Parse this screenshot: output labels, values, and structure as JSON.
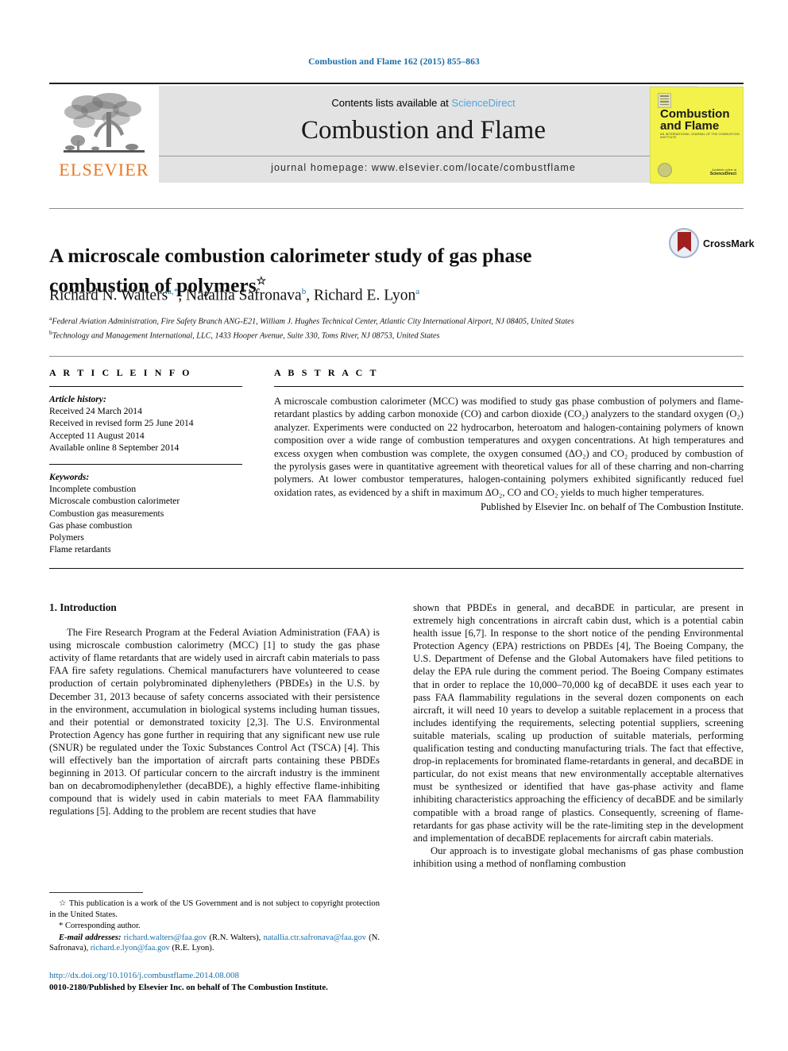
{
  "running_head": "Combustion and Flame 162 (2015) 855–863",
  "masthead": {
    "contents_prefix": "Contents lists available at ",
    "sciencedirect": "ScienceDirect",
    "journal_title": "Combustion and Flame",
    "homepage": "journal homepage: www.elsevier.com/locate/combustflame",
    "publisher_logo_text": "ELSEVIER",
    "cover": {
      "title_line1": "Combustion",
      "title_line2": "and Flame",
      "subtitle": "AN INTERNATIONAL JOURNAL OF THE COMBUSTION INSTITUTE",
      "footer_small": "Available online at",
      "footer_brand": "ScienceDirect"
    }
  },
  "article": {
    "title": "A microscale combustion calorimeter study of gas phase combustion of polymers",
    "title_footnote_marker": "☆",
    "crossmark_label": "CrossMark",
    "authors": [
      {
        "name": "Richard N. Walters",
        "sup": "a,*"
      },
      {
        "name": "Natallia Safronava",
        "sup": "b"
      },
      {
        "name": "Richard E. Lyon",
        "sup": "a"
      }
    ],
    "affiliations": [
      {
        "marker": "a",
        "text": "Federal Aviation Administration, Fire Safety Branch ANG-E21, William J. Hughes Technical Center, Atlantic City International Airport, NJ 08405, United States"
      },
      {
        "marker": "b",
        "text": "Technology and Management International, LLC, 1433 Hooper Avenue, Suite 330, Toms River, NJ 08753, United States"
      }
    ]
  },
  "article_info": {
    "heading": "A R T I C L E   I N F O",
    "history_label": "Article history:",
    "history": [
      "Received 24 March 2014",
      "Received in revised form 25 June 2014",
      "Accepted 11 August 2014",
      "Available online 8 September 2014"
    ],
    "keywords_label": "Keywords:",
    "keywords": [
      "Incomplete combustion",
      "Microscale combustion calorimeter",
      "Combustion gas measurements",
      "Gas phase combustion",
      "Polymers",
      "Flame retardants"
    ]
  },
  "abstract": {
    "heading": "A B S T R A C T",
    "body": "A microscale combustion calorimeter (MCC) was modified to study gas phase combustion of polymers and flame-retardant plastics by adding carbon monoxide (CO) and carbon dioxide (CO₂) analyzers to the standard oxygen (O₂) analyzer. Experiments were conducted on 22 hydrocarbon, heteroatom and halogen-containing polymers of known composition over a wide range of combustion temperatures and oxygen concentrations. At high temperatures and excess oxygen when combustion was complete, the oxygen consumed (ΔO₂) and CO₂ produced by combustion of the pyrolysis gases were in quantitative agreement with theoretical values for all of these charring and non-charring polymers. At lower combustor temperatures, halogen-containing polymers exhibited significantly reduced fuel oxidation rates, as evidenced by a shift in maximum ΔO₂, CO and CO₂ yields to much higher temperatures.",
    "publisher_line": "Published by Elsevier Inc. on behalf of The Combustion Institute."
  },
  "body": {
    "section_heading": "1. Introduction",
    "left_paragraph": "The Fire Research Program at the Federal Aviation Administration (FAA) is using microscale combustion calorimetry (MCC) [1] to study the gas phase activity of flame retardants that are widely used in aircraft cabin materials to pass FAA fire safety regulations. Chemical manufacturers have volunteered to cease production of certain polybrominated diphenylethers (PBDEs) in the U.S. by December 31, 2013 because of safety concerns associated with their persistence in the environment, accumulation in biological systems including human tissues, and their potential or demonstrated toxicity [2,3]. The U.S. Environmental Protection Agency has gone further in requiring that any significant new use rule (SNUR) be regulated under the Toxic Substances Control Act (TSCA) [4]. This will effectively ban the importation of aircraft parts containing these PBDEs beginning in 2013. Of particular concern to the aircraft industry is the imminent ban on decabromodiphenylether (decaBDE), a highly effective flame-inhibiting compound that is widely used in cabin materials to meet FAA flammability regulations [5]. Adding to the problem are recent studies that have",
    "right_paragraph_1": "shown that PBDEs in general, and decaBDE in particular, are present in extremely high concentrations in aircraft cabin dust, which is a potential cabin health issue [6,7]. In response to the short notice of the pending Environmental Protection Agency (EPA) restrictions on PBDEs [4], The Boeing Company, the U.S. Department of Defense and the Global Automakers have filed petitions to delay the EPA rule during the comment period. The Boeing Company estimates that in order to replace the 10,000–70,000 kg of decaBDE it uses each year to pass FAA flammability regulations in the several dozen components on each aircraft, it will need 10 years to develop a suitable replacement in a process that includes identifying the requirements, selecting potential suppliers, screening suitable materials, scaling up production of suitable materials, performing qualification testing and conducting manufacturing trials. The fact that effective, drop-in replacements for brominated flame-retardants in general, and decaBDE in particular, do not exist means that new environmentally acceptable alternatives must be synthesized or identified that have gas-phase activity and flame inhibiting characteristics approaching the efficiency of decaBDE and be similarly compatible with a broad range of plastics. Consequently, screening of flame-retardants for gas phase activity will be the rate-limiting step in the development and implementation of decaBDE replacements for aircraft cabin materials.",
    "right_paragraph_2": "Our approach is to investigate global mechanisms of gas phase combustion inhibition using a method of nonflaming combustion"
  },
  "footnotes": {
    "star_marker": "☆",
    "star_text": "This publication is a work of the US Government and is not subject to copyright protection in the United States.",
    "corresponding_marker": "*",
    "corresponding_text": "Corresponding author.",
    "email_label": "E-mail addresses:",
    "emails": [
      {
        "address": "richard.walters@faa.gov",
        "owner": "(R.N. Walters)"
      },
      {
        "address": "natallia.ctr.safronava@faa.gov",
        "owner": "(N. Safronava)"
      },
      {
        "address": "richard.e.lyon@faa.gov",
        "owner": "(R.E. Lyon)"
      }
    ]
  },
  "footer": {
    "doi": "http://dx.doi.org/10.1016/j.combustflame.2014.08.008",
    "copyright": "0010-2180/Published by Elsevier Inc. on behalf of The Combustion Institute."
  },
  "colors": {
    "link_blue": "#1a6fa8",
    "sciencedirect_blue": "#4da6e0",
    "elsevier_orange": "#e87722",
    "band_gray": "#e3e3e3",
    "cover_yellow": "#f2f24a"
  }
}
